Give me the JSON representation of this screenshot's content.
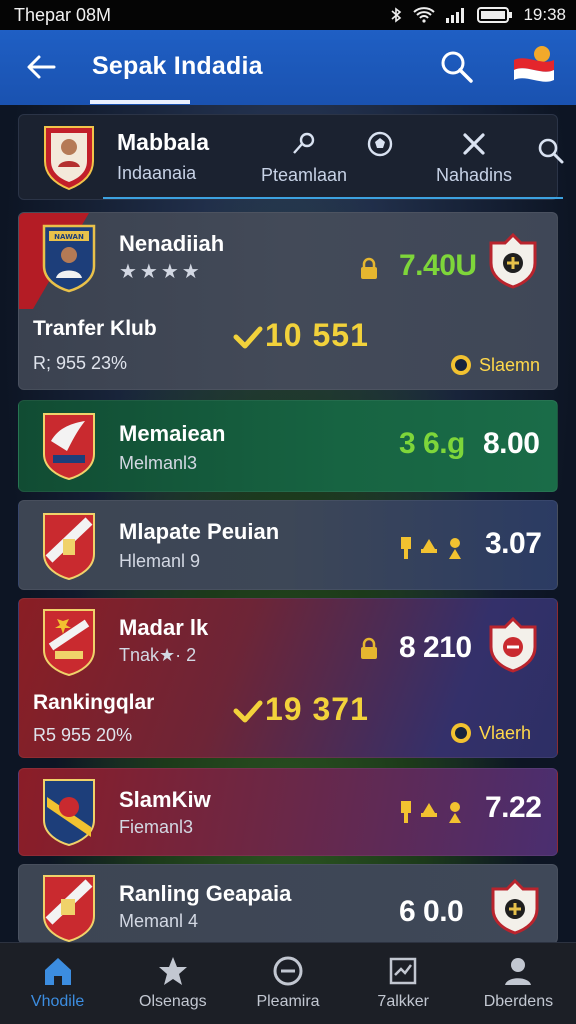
{
  "status_bar": {
    "left": "Thepar 08M",
    "time": "19:38"
  },
  "app_bar": {
    "title": "Sepak Indadia"
  },
  "profile": {
    "name": "Mabbala",
    "subtitle": "Indaanaia",
    "tabs": [
      {
        "label": "Pteamlaan",
        "icon": "whistle-icon"
      },
      {
        "label": "",
        "icon": "ball-icon"
      },
      {
        "label": "Nahadins",
        "icon": "cross-icon"
      },
      {
        "label": "",
        "icon": "search-icon"
      }
    ]
  },
  "rows": [
    {
      "name": "Nenadiiah",
      "stars": "★★★★",
      "badge_text": "NAWAN",
      "value": "7.40U",
      "value_color": "#7ed63a",
      "label": "Tranfer Klub",
      "sub_label": "R; 955 23%",
      "big_value": "10  551",
      "chip": "Slaemn"
    },
    {
      "name": "Memaiean",
      "sub": "Melmanl3",
      "value_green": "3 6.g",
      "value": "8.00"
    },
    {
      "name": "Mlapate Peuian",
      "sub": "Hlemanl 9",
      "value": "3.07"
    },
    {
      "name": "Madar  lk",
      "sub": "Tnak★· 2",
      "value": "8 210",
      "label": "Rankingqlar",
      "sub_label": "R5 955 20%",
      "big_value": "19  371",
      "chip": "Vlaerh"
    },
    {
      "name": "SlamKiw",
      "sub": "Fiemanl3",
      "value": "7.22"
    },
    {
      "name": "Ranling Geapaia",
      "sub": "Memanl 4",
      "value": "6 0.0"
    }
  ],
  "bottom_nav": [
    {
      "label": "Vhodile",
      "icon": "home-icon",
      "active": true
    },
    {
      "label": "Olsenags",
      "icon": "star-icon",
      "active": false
    },
    {
      "label": "Pleamira",
      "icon": "minus-circle-icon",
      "active": false
    },
    {
      "label": "7alkker",
      "icon": "chart-icon",
      "active": false
    },
    {
      "label": "Dberdens",
      "icon": "profile-icon",
      "active": false
    }
  ],
  "colors": {
    "app_bar": "#1f5fc4",
    "accent_green": "#7ed63a",
    "accent_yellow": "#f2d23b",
    "nav_active": "#3c8de0"
  }
}
